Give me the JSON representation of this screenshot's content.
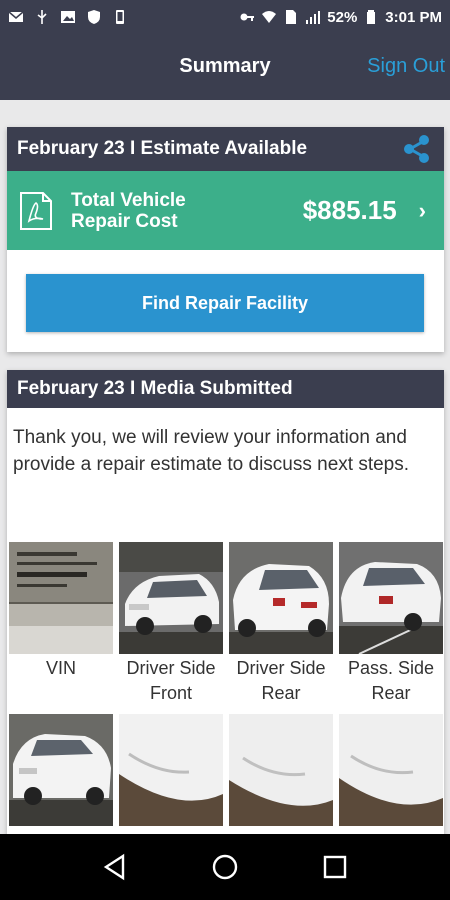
{
  "status": {
    "battery": "52%",
    "time": "3:01 PM"
  },
  "header": {
    "title": "Summary",
    "sign_out": "Sign Out"
  },
  "estimate_card": {
    "title": "February 23 I Estimate Available",
    "cost_label_line1": "Total Vehicle",
    "cost_label_line2": "Repair Cost",
    "cost_value": "$885.15",
    "find_button": "Find Repair Facility"
  },
  "media_card": {
    "title": "February 23 I Media Submitted",
    "message": "Thank you, we will review your information and provide a repair estimate to discuss next steps.",
    "tiles": [
      {
        "label": "VIN"
      },
      {
        "label": "Driver Side Front"
      },
      {
        "label": "Driver Side Rear"
      },
      {
        "label": "Pass. Side Rear"
      }
    ]
  },
  "colors": {
    "header_bg": "#3b3e4f",
    "accent_blue": "#2a93cf",
    "cost_green": "#3caf8a"
  }
}
